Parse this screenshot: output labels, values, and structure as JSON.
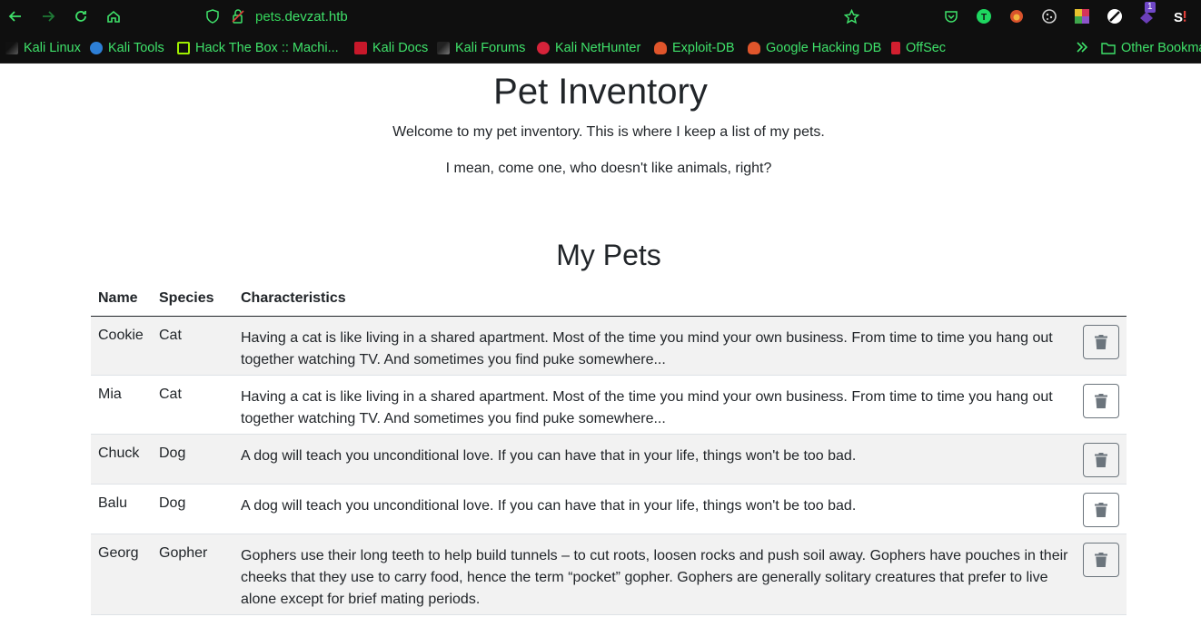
{
  "browser": {
    "url_prefix": "pets.",
    "url_host": "devzat.htb",
    "bookmarks": [
      "Kali Linux",
      "Kali Tools",
      "Hack The Box :: Machi...",
      "Kali Docs",
      "Kali Forums",
      "Kali NetHunter",
      "Exploit-DB",
      "Google Hacking DB",
      "OffSec"
    ],
    "other_bookmarks": "Other Bookma",
    "extension_badge": "1",
    "accent_color": "#3fe26a"
  },
  "page": {
    "title": "Pet Inventory",
    "intro_1": "Welcome to my pet inventory. This is where I keep a list of my pets.",
    "intro_2": "I mean, come one, who doesn't like animals, right?",
    "section_title": "My Pets"
  },
  "table": {
    "headers": {
      "name": "Name",
      "species": "Species",
      "characteristics": "Characteristics"
    },
    "rows": [
      {
        "name": "Cookie",
        "species": "Cat",
        "characteristics": "Having a cat is like living in a shared apartment. Most of the time you mind your own business. From time to time you hang out together watching TV. And sometimes you find puke somewhere..."
      },
      {
        "name": "Mia",
        "species": "Cat",
        "characteristics": "Having a cat is like living in a shared apartment. Most of the time you mind your own business. From time to time you hang out together watching TV. And sometimes you find puke somewhere..."
      },
      {
        "name": "Chuck",
        "species": "Dog",
        "characteristics": "A dog will teach you unconditional love. If you can have that in your life, things won't be too bad."
      },
      {
        "name": "Balu",
        "species": "Dog",
        "characteristics": "A dog will teach you unconditional love. If you can have that in your life, things won't be too bad."
      },
      {
        "name": "Georg",
        "species": "Gopher",
        "characteristics": "Gophers use their long teeth to help build tunnels – to cut roots, loosen rocks and push soil away. Gophers have pouches in their cheeks that they use to carry food, hence the term “pocket” gopher. Gophers are generally solitary creatures that prefer to live alone except for brief mating periods."
      }
    ]
  }
}
